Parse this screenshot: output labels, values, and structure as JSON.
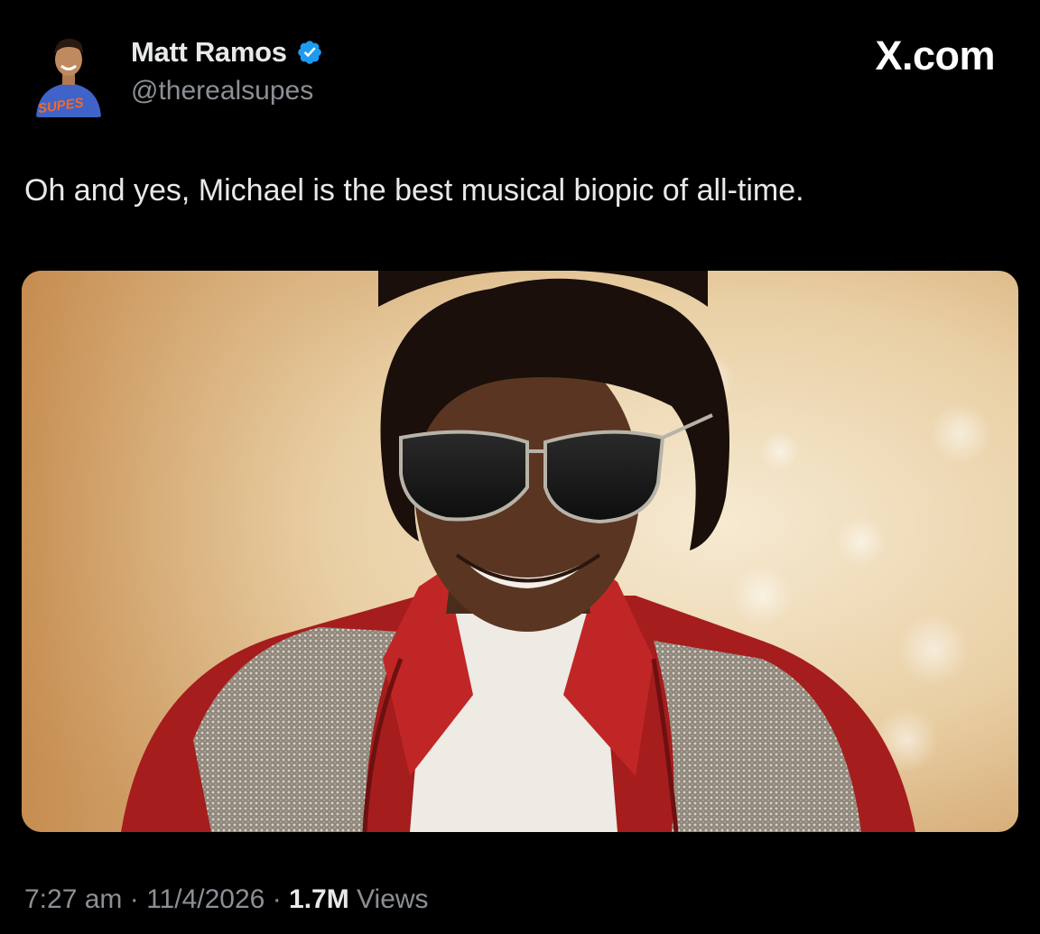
{
  "author": {
    "display_name": "Matt Ramos",
    "handle": "@therealsupes",
    "verified": true,
    "avatar_shirt_text": "SUPES"
  },
  "brand": {
    "label": "X.com"
  },
  "tweet": {
    "text": "Oh and yes, Michael is the best musical biopic of all-time."
  },
  "media": {
    "icon": "photo"
  },
  "meta": {
    "time": "7:27 am",
    "separator": "·",
    "date": "11/4/2026",
    "views_count": "1.7M",
    "views_label": "Views"
  },
  "colors": {
    "background": "#000000",
    "primary_text": "#e7e9ea",
    "secondary_text": "#8b9096",
    "verified_badge": "#1d9bf0"
  }
}
